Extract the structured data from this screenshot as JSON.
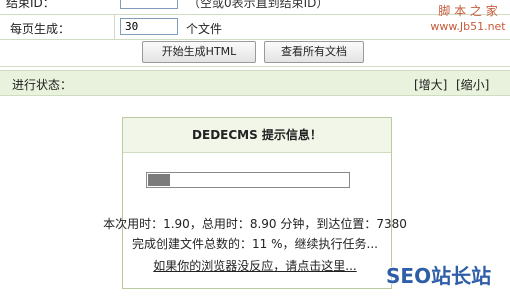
{
  "form": {
    "end_id_label": "结束ID：",
    "end_id_value": "",
    "end_id_hint": "（空或0表示直到结束ID）",
    "per_page_label": "每页生成：",
    "per_page_value": "30",
    "per_page_unit": "个文件",
    "generate_button": "开始生成HTML",
    "view_all_button": "查看所有文档"
  },
  "status": {
    "title": "进行状态：",
    "enlarge": "[增大]",
    "shrink": "[缩小]"
  },
  "message": {
    "header": "DEDECMS 提示信息！",
    "progress_percent": 11,
    "line1": "本次用时：1.90，总用时：8.90 分钟，到达位置：7380",
    "line2": "完成创建文件总数的：11 %，继续执行任务...",
    "link": "如果你的浏览器没反应，请点击这里..."
  },
  "watermarks": {
    "top_right_title": "脚 本 之 家",
    "top_right_url": "www.Jb51.net",
    "bottom_right": "SEO站长站"
  },
  "colors": {
    "status_bar_bg": "#e9f2dd",
    "progress_fill": "#7c7c7c",
    "watermark_blue": "#2e5ea8"
  }
}
